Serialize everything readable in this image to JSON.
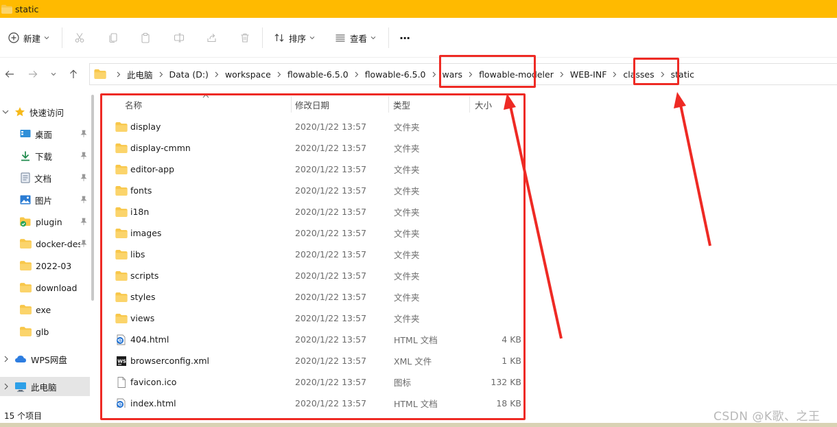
{
  "window": {
    "title": "static"
  },
  "toolbar": {
    "new_label": "新建",
    "sort_label": "排序",
    "view_label": "查看",
    "more_label": "···"
  },
  "breadcrumb": [
    "此电脑",
    "Data (D:)",
    "workspace",
    "flowable-6.5.0",
    "flowable-6.5.0",
    "wars",
    "flowable-modeler",
    "WEB-INF",
    "classes",
    "static"
  ],
  "sidebar": {
    "items": [
      {
        "label": "快速访问",
        "icon": "star-icon",
        "pinned": false
      },
      {
        "label": "桌面",
        "icon": "desktop-icon",
        "pinned": true
      },
      {
        "label": "下载",
        "icon": "download-icon",
        "pinned": true
      },
      {
        "label": "文档",
        "icon": "document-icon",
        "pinned": true
      },
      {
        "label": "图片",
        "icon": "picture-icon",
        "pinned": true
      },
      {
        "label": "plugin",
        "icon": "folder-check-icon",
        "pinned": true
      },
      {
        "label": "docker-des",
        "icon": "folder-icon",
        "pinned": true
      },
      {
        "label": "2022-03",
        "icon": "folder-icon",
        "pinned": false
      },
      {
        "label": "download",
        "icon": "folder-icon",
        "pinned": false
      },
      {
        "label": "exe",
        "icon": "folder-icon",
        "pinned": false
      },
      {
        "label": "glb",
        "icon": "folder-icon",
        "pinned": false
      },
      {
        "label": "WPS网盘",
        "icon": "cloud-icon",
        "pinned": false
      },
      {
        "label": "此电脑",
        "icon": "computer-icon",
        "pinned": false
      }
    ]
  },
  "columns": {
    "name": "名称",
    "date": "修改日期",
    "type": "类型",
    "size": "大小"
  },
  "files": [
    {
      "name": "display",
      "date": "2020/1/22 13:57",
      "type": "文件夹",
      "size": "",
      "icon": "folder-icon"
    },
    {
      "name": "display-cmmn",
      "date": "2020/1/22 13:57",
      "type": "文件夹",
      "size": "",
      "icon": "folder-icon"
    },
    {
      "name": "editor-app",
      "date": "2020/1/22 13:57",
      "type": "文件夹",
      "size": "",
      "icon": "folder-icon"
    },
    {
      "name": "fonts",
      "date": "2020/1/22 13:57",
      "type": "文件夹",
      "size": "",
      "icon": "folder-icon"
    },
    {
      "name": "i18n",
      "date": "2020/1/22 13:57",
      "type": "文件夹",
      "size": "",
      "icon": "folder-icon"
    },
    {
      "name": "images",
      "date": "2020/1/22 13:57",
      "type": "文件夹",
      "size": "",
      "icon": "folder-icon"
    },
    {
      "name": "libs",
      "date": "2020/1/22 13:57",
      "type": "文件夹",
      "size": "",
      "icon": "folder-icon"
    },
    {
      "name": "scripts",
      "date": "2020/1/22 13:57",
      "type": "文件夹",
      "size": "",
      "icon": "folder-icon"
    },
    {
      "name": "styles",
      "date": "2020/1/22 13:57",
      "type": "文件夹",
      "size": "",
      "icon": "folder-icon"
    },
    {
      "name": "views",
      "date": "2020/1/22 13:57",
      "type": "文件夹",
      "size": "",
      "icon": "folder-icon"
    },
    {
      "name": "404.html",
      "date": "2020/1/22 13:57",
      "type": "HTML 文档",
      "size": "4 KB",
      "icon": "html-file-icon"
    },
    {
      "name": "browserconfig.xml",
      "date": "2020/1/22 13:57",
      "type": "XML 文件",
      "size": "1 KB",
      "icon": "xml-file-icon"
    },
    {
      "name": "favicon.ico",
      "date": "2020/1/22 13:57",
      "type": "图标",
      "size": "132 KB",
      "icon": "ico-file-icon"
    },
    {
      "name": "index.html",
      "date": "2020/1/22 13:57",
      "type": "HTML 文档",
      "size": "18 KB",
      "icon": "html-file-icon"
    }
  ],
  "status": {
    "item_count": "15 个项目"
  },
  "watermark": "CSDN @K歌、之王",
  "colors": {
    "titlebar": "#ffba00",
    "annotation_red": "#ee2a24",
    "folder": "#f8c74a",
    "selection": "#e5e5e5"
  }
}
